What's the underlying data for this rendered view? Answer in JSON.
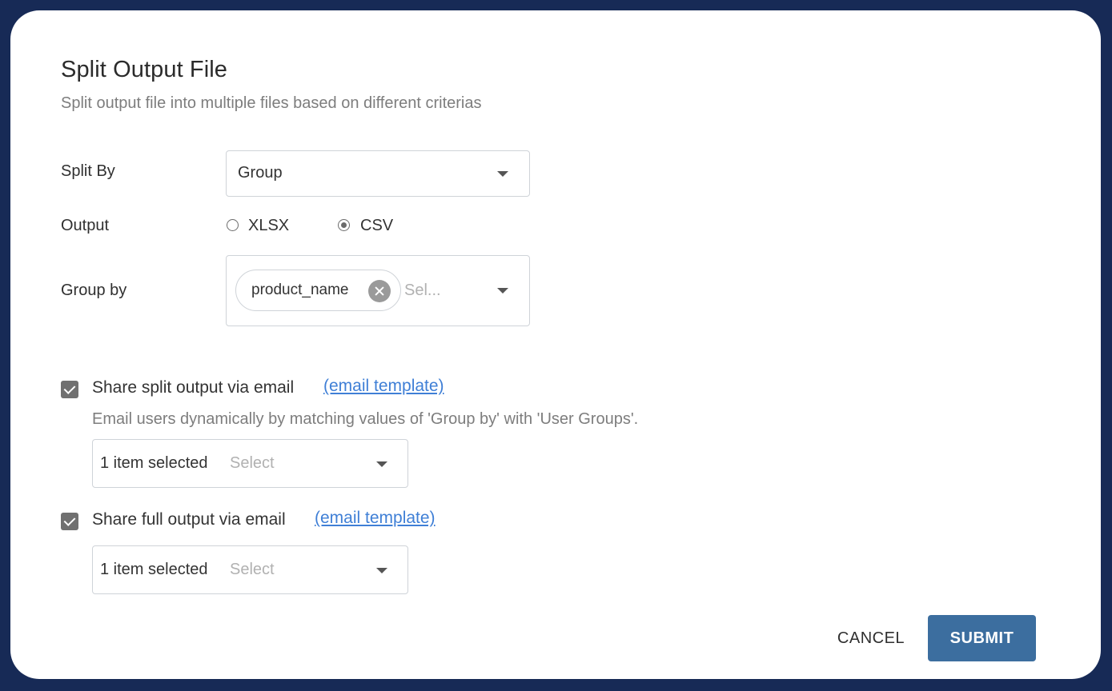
{
  "dialog": {
    "title": "Split Output File",
    "subtitle": "Split output file into multiple files based on different criterias"
  },
  "split_by": {
    "label": "Split By",
    "selected": "Group"
  },
  "output": {
    "label": "Output",
    "options": [
      {
        "label": "XLSX",
        "checked": false
      },
      {
        "label": "CSV",
        "checked": true
      }
    ]
  },
  "group_by": {
    "label": "Group by",
    "chips": [
      "product_name"
    ],
    "placeholder": "Sel..."
  },
  "share_split": {
    "checked": true,
    "label": "Share split output via email",
    "link": "(email template)",
    "helper": "Email users dynamically by matching values of 'Group by' with 'User Groups'.",
    "selected_text": "1 item selected",
    "placeholder": "Select"
  },
  "share_full": {
    "checked": true,
    "label": "Share full output via email",
    "link": "(email template)",
    "selected_text": "1 item selected",
    "placeholder": "Select"
  },
  "actions": {
    "cancel_label": "CANCEL",
    "submit_label": "SUBMIT"
  },
  "colors": {
    "frame": "#172a56",
    "primary_button": "#3c6e9f",
    "link": "#3f7fd6"
  },
  "icons": {
    "dropdown": "chevron-down-icon",
    "chip_remove": "close-circle-icon",
    "checkbox": "check-icon"
  }
}
